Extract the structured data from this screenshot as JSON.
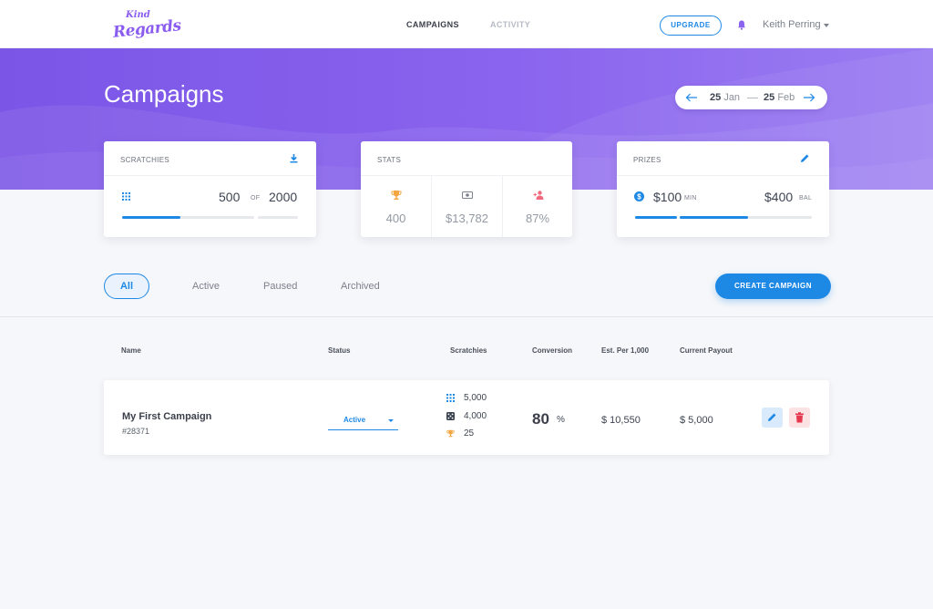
{
  "nav": {
    "logo_line1": "Kind",
    "logo_line2": "Regards",
    "tabs": [
      "CAMPAIGNS",
      "ACTIVITY"
    ],
    "upgrade_label": "UPGRADE",
    "user_name": "Keith Perring"
  },
  "hero": {
    "title": "Campaigns",
    "date_start_day": "25",
    "date_start_month": "Jan",
    "date_end_day": "25",
    "date_end_month": "Feb"
  },
  "cards": {
    "scratchies": {
      "title": "SCRATCHIES",
      "used": "500",
      "of_label": "OF",
      "total": "2000",
      "progress": 0.44
    },
    "stats": {
      "title": "STATS",
      "wins": "400",
      "revenue": "$13,782",
      "rate": "87%"
    },
    "prizes": {
      "title": "PRIZES",
      "min_value": "$100",
      "min_label": "MIN",
      "bal_value": "$400",
      "bal_label": "BAL",
      "progress": 0.52
    }
  },
  "filters": [
    "All",
    "Active",
    "Paused",
    "Archived"
  ],
  "create_label": "CREATE CAMPAIGN",
  "table": {
    "headers": [
      "Name",
      "Status",
      "Scratchies",
      "Conversion",
      "Est. Per 1,000",
      "Current Payout"
    ],
    "rows": [
      {
        "name": "My First Campaign",
        "id": "#28371",
        "status": "Active",
        "scratchies_total": "5,000",
        "scratchies_used": "4,000",
        "scratchies_won": "25",
        "conversion": "80",
        "conversion_unit": "%",
        "est_per_1000": "$ 10,550",
        "current_payout": "$ 5,000"
      }
    ]
  },
  "colors": {
    "accent": "#1e88e5",
    "hero_purple": "#8a64ee",
    "trophy": "#f4a640",
    "danger": "#e53950",
    "user_add": "#f06b80"
  }
}
